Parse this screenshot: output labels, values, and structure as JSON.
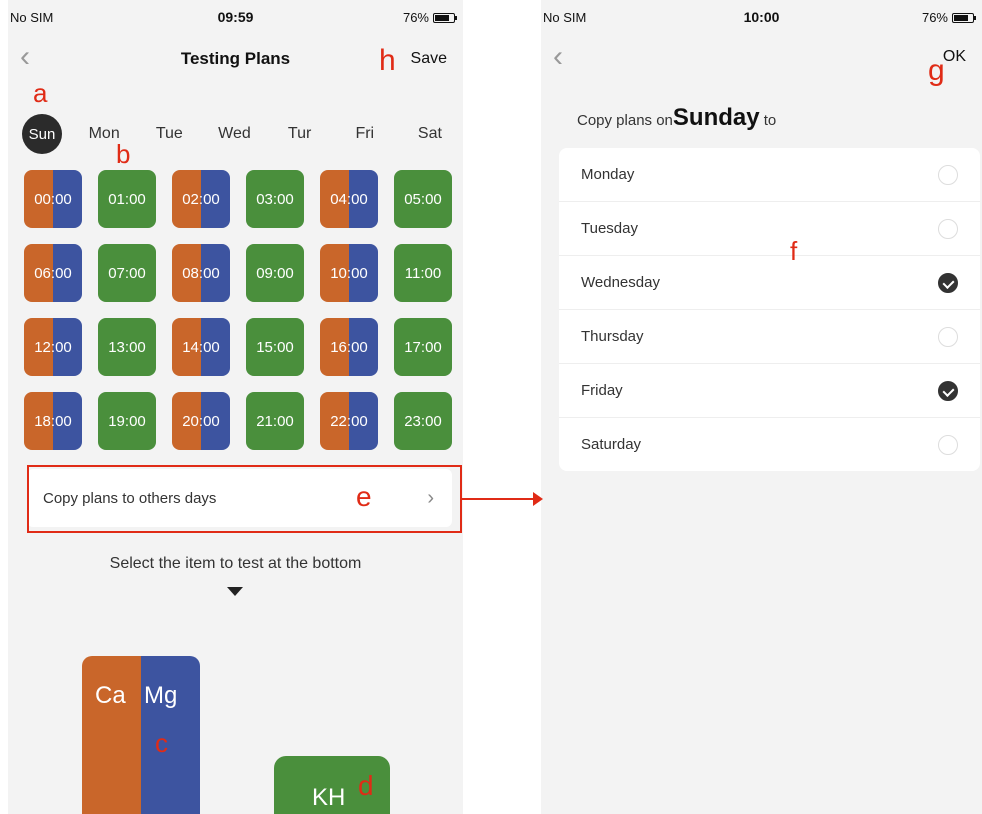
{
  "left": {
    "status": {
      "carrier": "No SIM",
      "time": "09:59",
      "battery": "76%"
    },
    "nav": {
      "title": "Testing Plans",
      "action": "Save"
    },
    "days": [
      {
        "label": "Sun",
        "active": true
      },
      {
        "label": "Mon",
        "active": false
      },
      {
        "label": "Tue",
        "active": false
      },
      {
        "label": "Wed",
        "active": false
      },
      {
        "label": "Tur",
        "active": false
      },
      {
        "label": "Fri",
        "active": false
      },
      {
        "label": "Sat",
        "active": false
      }
    ],
    "slots": [
      {
        "time": "00:00",
        "type": "split"
      },
      {
        "time": "01:00",
        "type": "green"
      },
      {
        "time": "02:00",
        "type": "split"
      },
      {
        "time": "03:00",
        "type": "green"
      },
      {
        "time": "04:00",
        "type": "split"
      },
      {
        "time": "05:00",
        "type": "green"
      },
      {
        "time": "06:00",
        "type": "split"
      },
      {
        "time": "07:00",
        "type": "green"
      },
      {
        "time": "08:00",
        "type": "split"
      },
      {
        "time": "09:00",
        "type": "green"
      },
      {
        "time": "10:00",
        "type": "split"
      },
      {
        "time": "11:00",
        "type": "green"
      },
      {
        "time": "12:00",
        "type": "split"
      },
      {
        "time": "13:00",
        "type": "green"
      },
      {
        "time": "14:00",
        "type": "split"
      },
      {
        "time": "15:00",
        "type": "green"
      },
      {
        "time": "16:00",
        "type": "split"
      },
      {
        "time": "17:00",
        "type": "green"
      },
      {
        "time": "18:00",
        "type": "split"
      },
      {
        "time": "19:00",
        "type": "green"
      },
      {
        "time": "20:00",
        "type": "split"
      },
      {
        "time": "21:00",
        "type": "green"
      },
      {
        "time": "22:00",
        "type": "split"
      },
      {
        "time": "23:00",
        "type": "green"
      }
    ],
    "copy_row": {
      "label": "Copy plans to others days",
      "chevron": "›"
    },
    "hint": "Select the item to test at the bottom",
    "items": {
      "ca": "Ca",
      "mg": "Mg",
      "kh": "KH"
    }
  },
  "right": {
    "status": {
      "carrier": "No SIM",
      "time": "10:00",
      "battery": "76%"
    },
    "nav": {
      "action": "OK"
    },
    "copy_title": {
      "prefix": "Copy plans on",
      "day": "Sunday",
      "suffix": " to"
    },
    "options": [
      {
        "label": "Monday",
        "checked": false
      },
      {
        "label": "Tuesday",
        "checked": false
      },
      {
        "label": "Wednesday",
        "checked": true
      },
      {
        "label": "Thursday",
        "checked": false
      },
      {
        "label": "Friday",
        "checked": true
      },
      {
        "label": "Saturday",
        "checked": false
      }
    ]
  },
  "annotations": {
    "a": "a",
    "b": "b",
    "c": "c",
    "d": "d",
    "e": "e",
    "f": "f",
    "g": "g",
    "h": "h"
  },
  "colors": {
    "green": "#4a8f3c",
    "orange": "#c9662a",
    "blue": "#3d54a0",
    "annotation_red": "#e02b16"
  }
}
